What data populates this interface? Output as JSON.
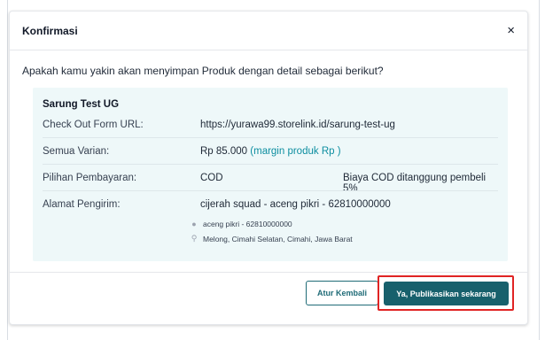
{
  "dialog": {
    "title": "Konfirmasi",
    "close_symbol": "×",
    "question": "Apakah kamu yakin akan menyimpan Produk dengan detail sebagai berikut?"
  },
  "detail": {
    "product_name": "Sarung Test UG",
    "rows": [
      {
        "label": "Check Out Form URL:",
        "value": "https://yurawa99.storelink.id/sarung-test-ug"
      },
      {
        "label": "Semua Varian:",
        "value": "Rp 85.000",
        "note": "(margin produk Rp )"
      },
      {
        "label": "Pilihan Pembayaran:",
        "value": "COD",
        "extra": "Biaya COD ditanggung pembeli 5%"
      },
      {
        "label": "Alamat Pengirim:",
        "value": "cijerah squad - aceng pikri - 62810000000"
      }
    ],
    "sender_contact": "aceng pikri - 62810000000",
    "sender_location": "Melong, Cimahi Selatan, Cimahi, Jawa Barat"
  },
  "buttons": {
    "reset": "Atur Kembali",
    "publish": "Ya, Publikasikan sekarang"
  },
  "colors": {
    "panel_bg": "#eef8f9",
    "primary": "#17606c",
    "link": "#0d7c8e",
    "highlight": "#e02424"
  },
  "icons": {
    "close": "close-icon",
    "person": "person-icon",
    "location": "location-pin-icon"
  }
}
